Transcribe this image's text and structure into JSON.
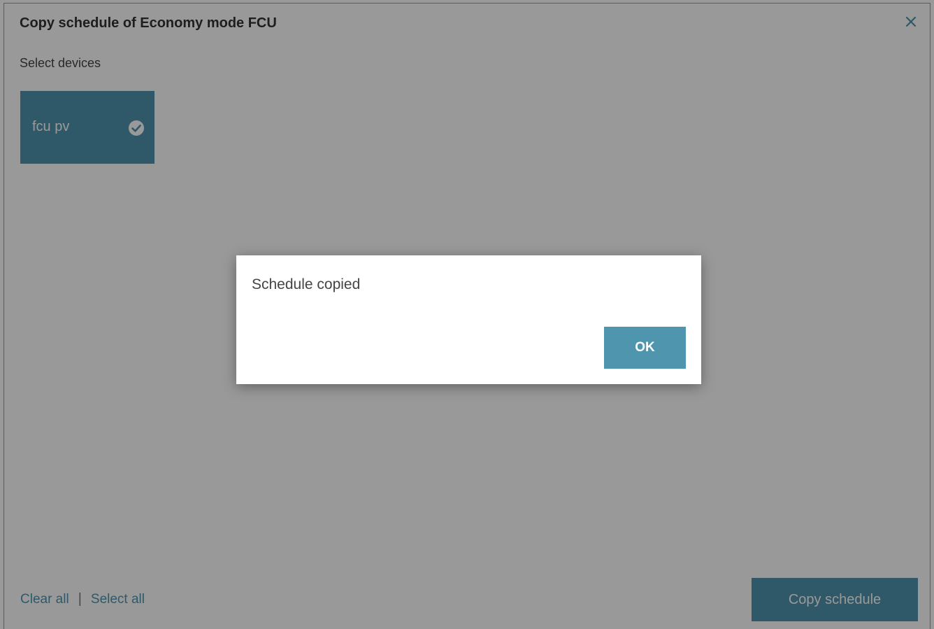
{
  "dialog": {
    "title": "Copy schedule of Economy mode FCU",
    "subtitle": "Select devices",
    "close_icon": "close-icon"
  },
  "devices": [
    {
      "label": "fcu pv",
      "selected": true,
      "icon": "check-circle-icon"
    }
  ],
  "footer": {
    "clear_all": "Clear all",
    "separator": "|",
    "select_all": "Select all",
    "copy_button": "Copy schedule"
  },
  "modal": {
    "message": "Schedule copied",
    "ok_button": "OK"
  },
  "colors": {
    "accent": "#4f95ae",
    "overlay": "rgba(0,0,0,0.40)"
  }
}
